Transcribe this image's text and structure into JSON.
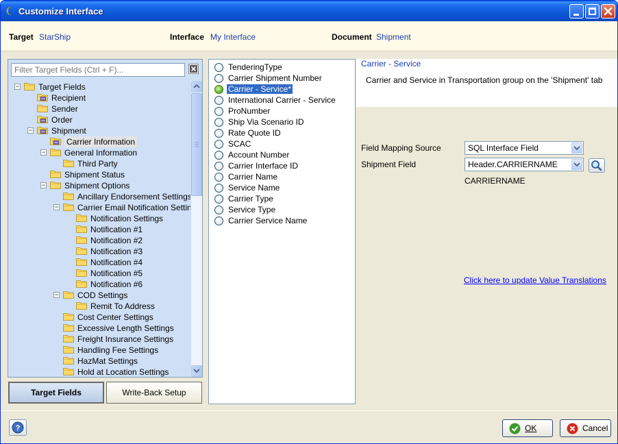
{
  "window": {
    "title": "Customize Interface"
  },
  "info": {
    "target_label": "Target",
    "target_value": "StarShip",
    "interface_label": "Interface",
    "interface_value": "My Interface",
    "document_label": "Document",
    "document_value": "Shipment"
  },
  "left": {
    "filter_placeholder": "Filter Target Fields (Ctrl + F)...",
    "tree": [
      {
        "label": "Target Fields",
        "level": 0,
        "expander": "-",
        "icon": "folder"
      },
      {
        "label": "Recipient",
        "level": 1,
        "expander": "",
        "icon": "folder-linked"
      },
      {
        "label": "Sender",
        "level": 1,
        "expander": "",
        "icon": "folder"
      },
      {
        "label": "Order",
        "level": 1,
        "expander": "",
        "icon": "folder-linked"
      },
      {
        "label": "Shipment",
        "level": 1,
        "expander": "-",
        "icon": "folder-linked"
      },
      {
        "label": "Carrier Information",
        "level": 2,
        "expander": "",
        "icon": "folder-linked",
        "selected": true
      },
      {
        "label": "General Information",
        "level": 2,
        "expander": "-",
        "icon": "folder"
      },
      {
        "label": "Third Party",
        "level": 3,
        "expander": "",
        "icon": "folder"
      },
      {
        "label": "Shipment Status",
        "level": 2,
        "expander": "",
        "icon": "folder"
      },
      {
        "label": "Shipment Options",
        "level": 2,
        "expander": "-",
        "icon": "folder"
      },
      {
        "label": "Ancillary Endorsement Settings",
        "level": 3,
        "expander": "",
        "icon": "folder"
      },
      {
        "label": "Carrier Email Notification Settings",
        "level": 3,
        "expander": "-",
        "icon": "folder"
      },
      {
        "label": "Notification Settings",
        "level": 4,
        "expander": "",
        "icon": "folder"
      },
      {
        "label": "Notification #1",
        "level": 4,
        "expander": "",
        "icon": "folder"
      },
      {
        "label": "Notification #2",
        "level": 4,
        "expander": "",
        "icon": "folder"
      },
      {
        "label": "Notification #3",
        "level": 4,
        "expander": "",
        "icon": "folder"
      },
      {
        "label": "Notification #4",
        "level": 4,
        "expander": "",
        "icon": "folder"
      },
      {
        "label": "Notification #5",
        "level": 4,
        "expander": "",
        "icon": "folder"
      },
      {
        "label": "Notification #6",
        "level": 4,
        "expander": "",
        "icon": "folder"
      },
      {
        "label": "COD Settings",
        "level": 3,
        "expander": "-",
        "icon": "folder"
      },
      {
        "label": "Remit To Address",
        "level": 4,
        "expander": "",
        "icon": "folder"
      },
      {
        "label": "Cost Center Settings",
        "level": 3,
        "expander": "",
        "icon": "folder"
      },
      {
        "label": "Excessive Length Settings",
        "level": 3,
        "expander": "",
        "icon": "folder"
      },
      {
        "label": "Freight Insurance Settings",
        "level": 3,
        "expander": "",
        "icon": "folder"
      },
      {
        "label": "Handling Fee Settings",
        "level": 3,
        "expander": "",
        "icon": "folder"
      },
      {
        "label": "HazMat Settings",
        "level": 3,
        "expander": "",
        "icon": "folder"
      },
      {
        "label": "Hold at Location Settings",
        "level": 3,
        "expander": "",
        "icon": "folder"
      }
    ],
    "tab_target": "Target Fields",
    "tab_writeback": "Write-Back Setup"
  },
  "fields": [
    {
      "label": "TenderingType",
      "selected": false
    },
    {
      "label": "Carrier Shipment Number",
      "selected": false
    },
    {
      "label": "Carrier - Service*",
      "selected": true
    },
    {
      "label": "International Carrier - Service",
      "selected": false
    },
    {
      "label": "ProNumber",
      "selected": false
    },
    {
      "label": "Ship Via Scenario ID",
      "selected": false
    },
    {
      "label": "Rate Quote ID",
      "selected": false
    },
    {
      "label": "SCAC",
      "selected": false
    },
    {
      "label": "Account Number",
      "selected": false
    },
    {
      "label": "Carrier Interface ID",
      "selected": false
    },
    {
      "label": "Carrier Name",
      "selected": false
    },
    {
      "label": "Service Name",
      "selected": false
    },
    {
      "label": "Carrier Type",
      "selected": false
    },
    {
      "label": "Service Type",
      "selected": false
    },
    {
      "label": "Carrier Service Name",
      "selected": false
    }
  ],
  "detail": {
    "title": "Carrier - Service",
    "description": "Carrier and Service in Transportation group on the 'Shipment' tab",
    "mapping_source_label": "Field Mapping Source",
    "mapping_source_value": "SQL Interface Field",
    "shipment_field_label": "Shipment Field",
    "shipment_field_value": "Header.CARRIERNAME",
    "mapped_name": "CARRIERNAME",
    "link": "Click here to update Value Translations"
  },
  "footer": {
    "ok_label": "OK",
    "cancel_label": "Cancel"
  },
  "colors": {
    "accent": "#316ac5",
    "link": "#0000ff",
    "info_value": "#1c3cae",
    "tree_bg": "#cfe0f6"
  }
}
